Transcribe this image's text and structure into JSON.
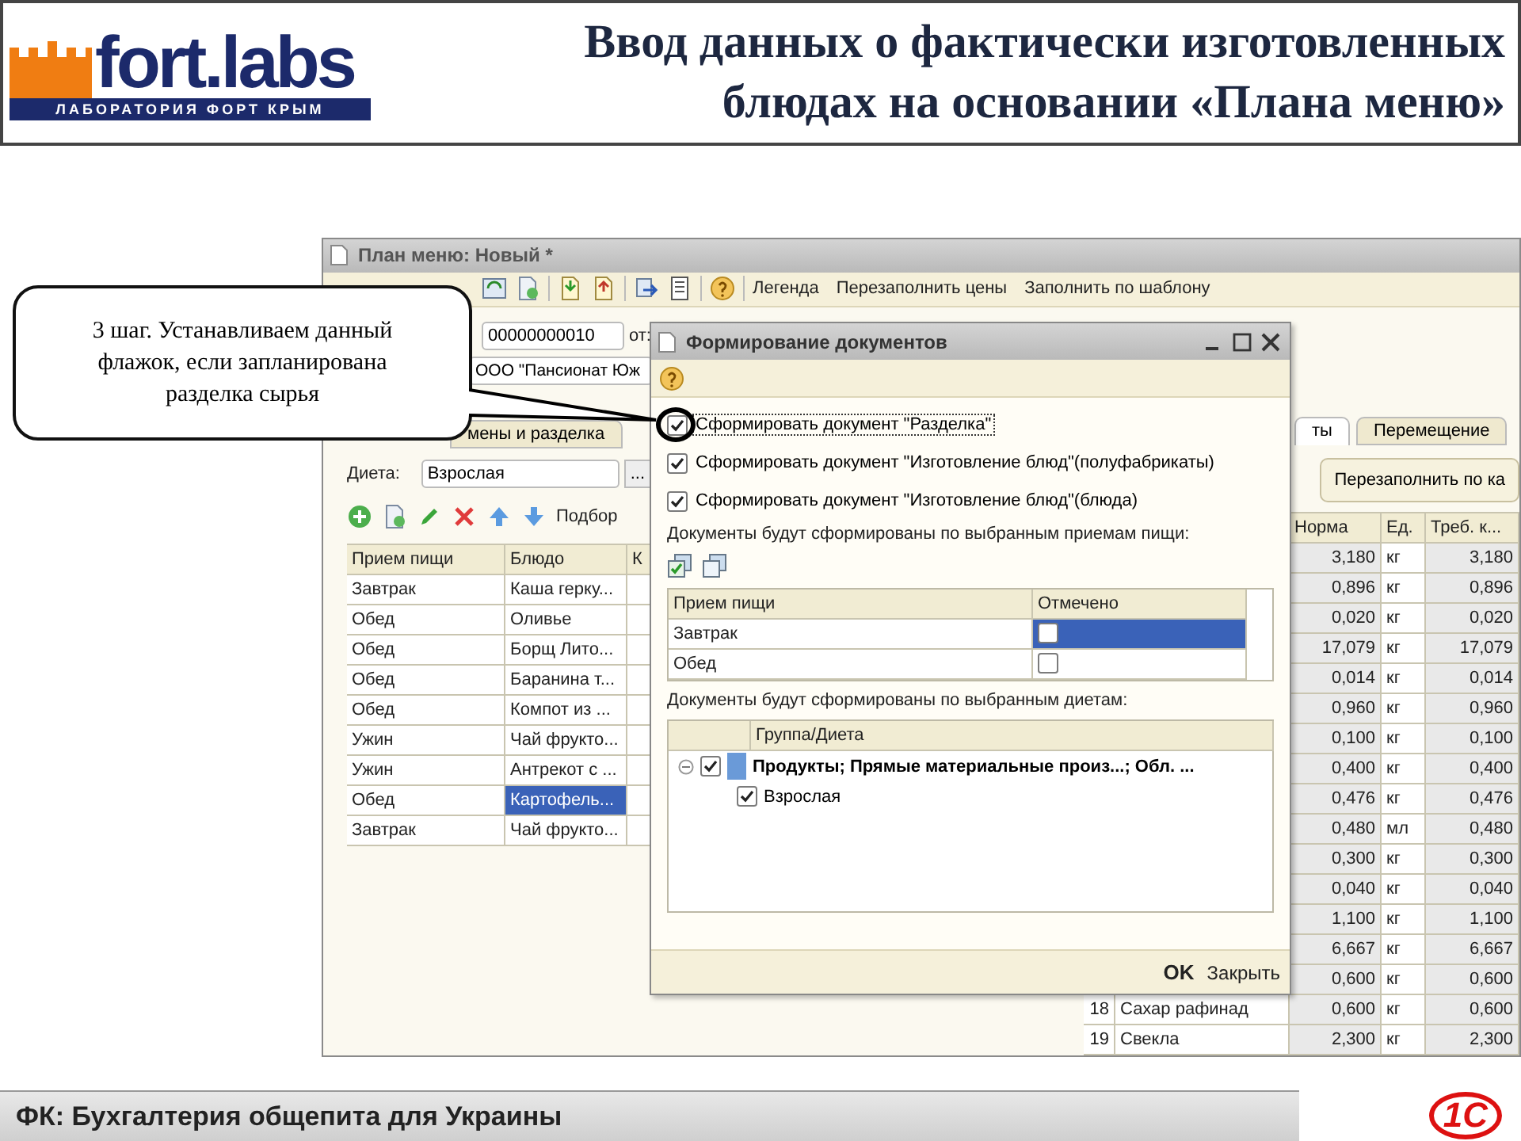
{
  "header": {
    "logo_text": "fort.labs",
    "logo_subtitle": "ЛАБОРАТОРИЯ ФОРТ КРЫМ",
    "title_lines": [
      "Ввод данных о фактически изготовленных",
      "блюдах на основании «Плана меню»"
    ]
  },
  "callout": {
    "text": "3 шаг. Устанавливаем данный флажок, если запланирована разделка сырья"
  },
  "main_window": {
    "title": "План меню: Новый *",
    "toolbar": [
      "Легенда",
      "Перезаполнить цены",
      "Заполнить по шаблону"
    ],
    "number": "00000000010",
    "date_label": "от:",
    "organization": "ООО \"Пансионат Юж",
    "left_tab": "мены и разделка",
    "right_tabs": [
      {
        "label": "ты",
        "selected": true
      },
      {
        "label": "Перемещение",
        "selected": false
      }
    ],
    "diet_label": "Диета:",
    "diet_value": "Взрослая",
    "diet_button": "...",
    "table_toolbar_label": "Подбор",
    "meals_table": {
      "columns": [
        "Прием пищи",
        "Блюдо",
        "К"
      ],
      "rows": [
        {
          "meal": "Завтрак",
          "dish": "Каша герку...",
          "selected": false
        },
        {
          "meal": "Обед",
          "dish": "Оливье",
          "selected": false
        },
        {
          "meal": "Обед",
          "dish": "Борщ Лито...",
          "selected": false
        },
        {
          "meal": "Обед",
          "dish": "Баранина т...",
          "selected": false
        },
        {
          "meal": "Обед",
          "dish": "Компот из ...",
          "selected": false
        },
        {
          "meal": "Ужин",
          "dish": "Чай фрукто...",
          "selected": false
        },
        {
          "meal": "Ужин",
          "dish": "Антрекот с ...",
          "selected": false
        },
        {
          "meal": "Обед",
          "dish": "Картофель...",
          "selected": true
        },
        {
          "meal": "Завтрак",
          "dish": "Чай фрукто...",
          "selected": false
        }
      ]
    },
    "refill_button": "Перезаполнить по ка",
    "norms_table": {
      "columns": [
        "Норма",
        "Ед.",
        "Треб. к..."
      ],
      "rows": [
        {
          "norm": "3,180",
          "unit": "кг",
          "required": "3,180"
        },
        {
          "norm": "0,896",
          "unit": "кг",
          "required": "0,896"
        },
        {
          "norm": "0,020",
          "unit": "кг",
          "required": "0,020"
        },
        {
          "norm": "17,079",
          "unit": "кг",
          "required": "17,079"
        },
        {
          "norm": "0,014",
          "unit": "кг",
          "required": "0,014"
        },
        {
          "norm": "0,960",
          "unit": "кг",
          "required": "0,960"
        },
        {
          "norm": "0,100",
          "unit": "кг",
          "required": "0,100"
        },
        {
          "norm": "0,400",
          "unit": "кг",
          "required": "0,400"
        },
        {
          "norm": "0,476",
          "unit": "кг",
          "required": "0,476"
        },
        {
          "norm": "0,480",
          "unit": "мл",
          "required": "0,480"
        },
        {
          "norm": "0,300",
          "unit": "кг",
          "required": "0,300"
        },
        {
          "norm": "0,040",
          "unit": "кг",
          "required": "0,040"
        },
        {
          "norm": "1,100",
          "unit": "кг",
          "required": "1,100"
        },
        {
          "norm": "6,667",
          "unit": "кг",
          "required": "6,667"
        },
        {
          "norm": "0,600",
          "unit": "кг",
          "required": "0,600"
        },
        {
          "number": "18",
          "name": "Сахар рафинад",
          "norm": "0,600",
          "unit": "кг",
          "required": "0,600"
        },
        {
          "number": "19",
          "name": "Свекла",
          "norm": "2,300",
          "unit": "кг",
          "required": "2,300"
        }
      ]
    }
  },
  "dialog": {
    "title": "Формирование документов",
    "options": [
      {
        "label": "Сформировать документ \"Разделка\"",
        "checked": true,
        "focused": true
      },
      {
        "label": "Сформировать документ \"Изготовление блюд\"(полуфабрикаты)",
        "checked": true,
        "focused": false
      },
      {
        "label": "Сформировать документ \"Изготовление блюд\"(блюда)",
        "checked": true,
        "focused": false
      }
    ],
    "meals_caption": "Документы будут сформированы по выбранным приемам пищи:",
    "meals_table": {
      "columns": [
        "Прием пищи",
        "Отмечено"
      ],
      "rows": [
        {
          "meal": "Завтрак",
          "checked": false,
          "selected": true
        },
        {
          "meal": "Обед",
          "checked": false,
          "selected": false
        }
      ]
    },
    "diets_caption": "Документы будут сформированы по выбранным диетам:",
    "diets_tree": {
      "column": "Группа/Диета",
      "items": [
        {
          "label": "Продукты; Прямые материальные произ...; Обл. ...",
          "checked": true,
          "expanded": true,
          "children": [
            {
              "label": "Взрослая",
              "checked": true
            }
          ]
        }
      ]
    },
    "ok": "OK",
    "close": "Закрыть"
  },
  "footer": {
    "text": "ФК: Бухгалтерия общепита для Украины",
    "logo_text": "1С"
  }
}
